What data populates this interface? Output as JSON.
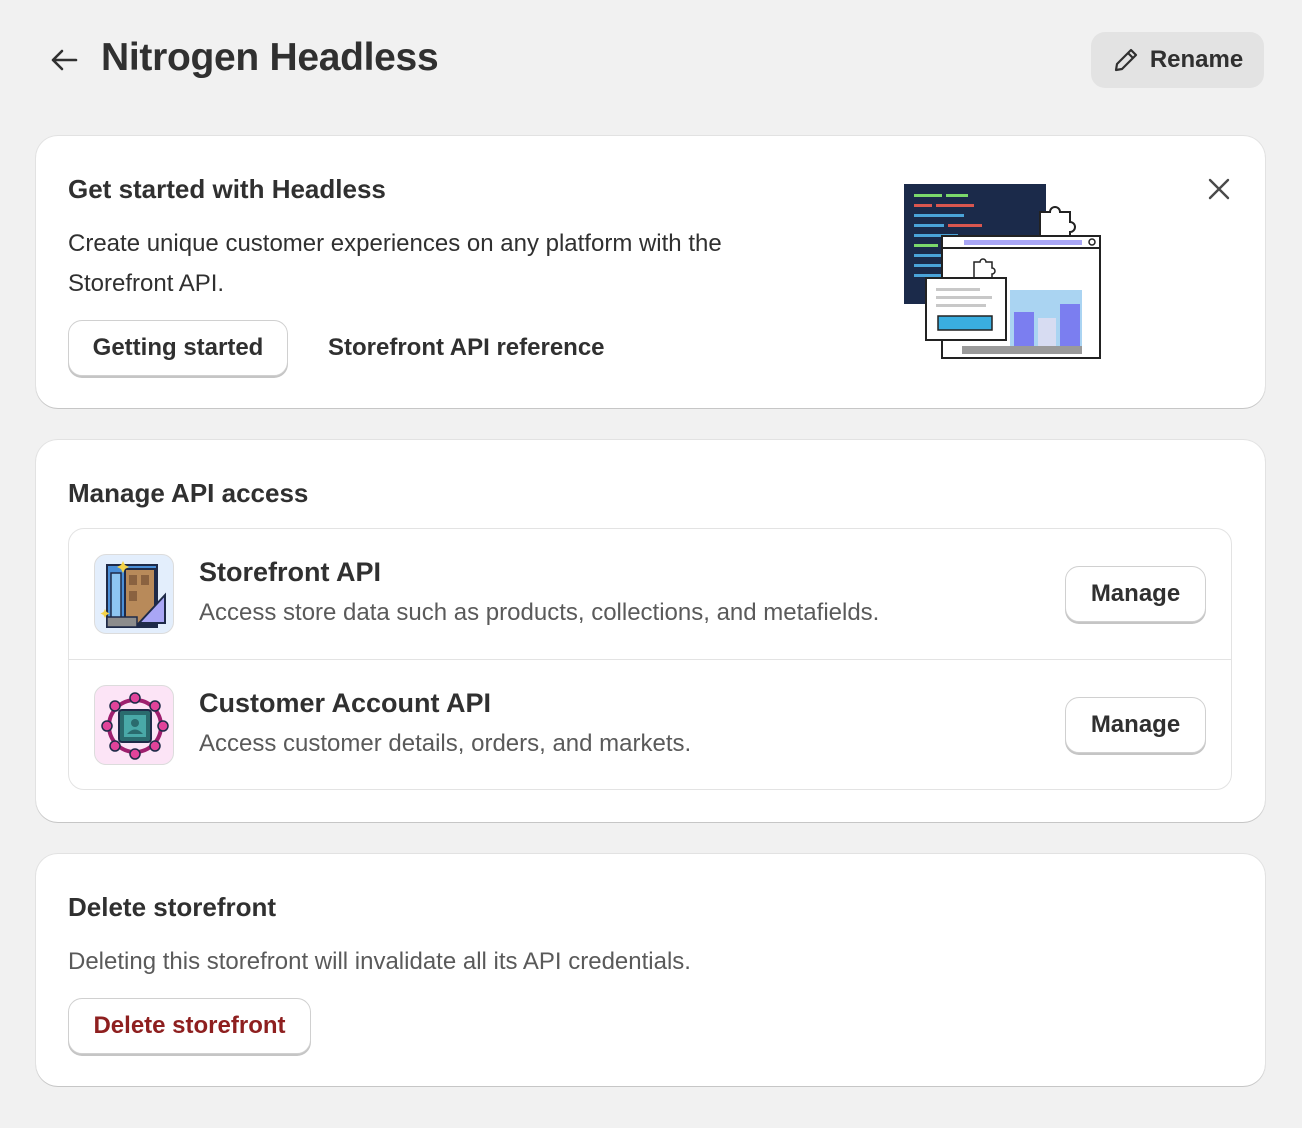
{
  "header": {
    "title": "Nitrogen Headless",
    "rename_label": "Rename"
  },
  "get_started": {
    "heading": "Get started with Headless",
    "description_line1": "Create unique customer experiences on any platform with the",
    "description_line2": "Storefront API.",
    "getting_started_label": "Getting started",
    "reference_label": "Storefront API reference"
  },
  "manage": {
    "heading": "Manage API access",
    "apis": [
      {
        "title": "Storefront API",
        "description": "Access store data such as products, collections, and metafields.",
        "action_label": "Manage",
        "icon": "storefront-door-icon",
        "icon_bg": "#e3eefc"
      },
      {
        "title": "Customer Account API",
        "description": "Access customer details, orders, and markets.",
        "action_label": "Manage",
        "icon": "customer-account-icon",
        "icon_bg": "#fce4f6"
      }
    ]
  },
  "delete": {
    "heading": "Delete storefront",
    "description": "Deleting this storefront will invalidate all its API credentials.",
    "button_label": "Delete storefront",
    "danger_color": "#8e1f1f"
  }
}
